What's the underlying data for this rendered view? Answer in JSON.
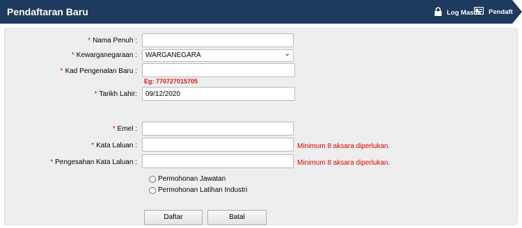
{
  "header": {
    "title": "Pendaftaran Baru",
    "login_label": "Log Masuk",
    "register_label": "Pendaft"
  },
  "form": {
    "required_mark": "*",
    "full_name": {
      "label": "Nama Penuh :",
      "value": ""
    },
    "citizenship": {
      "label": "Kewarganegaraan :",
      "value": "WARGANEGARA"
    },
    "ic": {
      "label": "Kad Pengenalan Baru :",
      "value": "",
      "hint": "Eg: 770727015705"
    },
    "dob": {
      "label": "Tarikh Lahir:",
      "value": "09/12/2020"
    },
    "email": {
      "label": "Emel :",
      "value": ""
    },
    "password": {
      "label": "Kata Laluan :",
      "value": "",
      "error": "Minimum 8 aksara diperlukan."
    },
    "confirm_password": {
      "label": "Pengesahan Kata Laluan :",
      "value": "",
      "error": "Minimum 8 aksara diperlukan."
    },
    "application_types": [
      "Permohonan Jawatan",
      "Permohonan Latihan Industri"
    ],
    "submit_label": "Daftar",
    "cancel_label": "Batal"
  },
  "colors": {
    "header_bg": "#1f3a5f",
    "required": "#e00000",
    "error": "#e00000",
    "hint": "#d11a1a",
    "panel_bg": "#eeeeee"
  }
}
